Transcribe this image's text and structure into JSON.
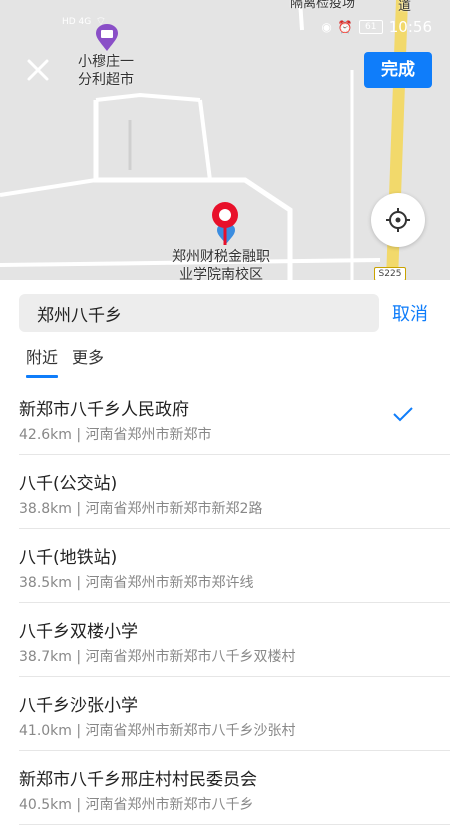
{
  "status_bar": {
    "signal_left": "HD 4G",
    "time": "10:56",
    "battery": "61"
  },
  "map": {
    "store_label_line1": "小穆庄一",
    "store_label_line2": "分利超市",
    "school_label_line1": "郑州财税金融职",
    "school_label_line2": "业学院南校区",
    "quarantine_label": "隔离检疫场",
    "road_label": "道",
    "highway_tag": "S225",
    "done_label": "完成",
    "icons": [
      "close-icon",
      "locate-icon",
      "location-pin-icon",
      "shopping-basket-icon",
      "school-icon"
    ]
  },
  "search": {
    "value": "郑州八千乡",
    "cancel_label": "取消"
  },
  "tabs": [
    "附近",
    "更多"
  ],
  "results": [
    {
      "name": "新郑市八千乡人民政府",
      "sub": "42.6km | 河南省郑州市新郑市"
    },
    {
      "name": "八千(公交站)",
      "sub": "38.8km | 河南省郑州市新郑市新郑2路"
    },
    {
      "name": "八千(地铁站)",
      "sub": "38.5km | 河南省郑州市新郑市郑许线"
    },
    {
      "name": "八千乡双楼小学",
      "sub": "38.7km | 河南省郑州市新郑市八千乡双楼村"
    },
    {
      "name": "八千乡沙张小学",
      "sub": "41.0km | 河南省郑州市新郑市八千乡沙张村"
    },
    {
      "name": "新郑市八千乡邢庄村村民委员会",
      "sub": "40.5km | 河南省郑州市新郑市八千乡"
    }
  ],
  "colors": {
    "accent": "#0f7dfa",
    "pin": "#e8102a",
    "road": "#f2d96b"
  }
}
